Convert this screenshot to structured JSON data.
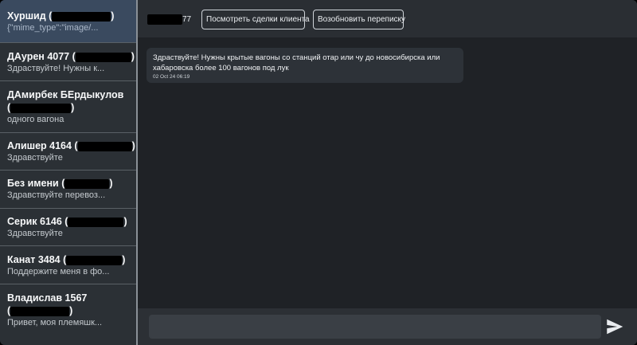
{
  "chats": [
    {
      "name_prefix": "Хуршид (",
      "name_suffix": ")",
      "preview": "{\"mime_type\":\"image/..."
    },
    {
      "name_prefix": "ДАурен 4077 (",
      "name_suffix": ")",
      "preview": "Здраствуйте! Нужны к..."
    },
    {
      "name_line1": "ДАмирбек БЕрдыкулов",
      "name_prefix": "(",
      "name_suffix": ")",
      "preview": "одного вагона"
    },
    {
      "name_prefix": "Алишер 4164 (",
      "name_suffix": ")",
      "preview": "Здравствуйте"
    },
    {
      "name_prefix": "Без имени (",
      "name_suffix": ")",
      "preview": "Здравствуйте перевоз..."
    },
    {
      "name_prefix": "Серик 6146 (",
      "name_suffix": ")",
      "preview": "Здравствуйте"
    },
    {
      "name_prefix": "Канат 3484 (",
      "name_suffix": ")",
      "preview": "Поддержите меня в фо..."
    },
    {
      "name_line1": "Владислав 1567",
      "name_prefix": "(",
      "name_suffix": ")",
      "preview": "Привет, моя племяшк..."
    }
  ],
  "header": {
    "contact_id_suffix": "77",
    "view_deals_label": "Посмотреть сделки клиента",
    "resume_label": "Возобновить переписку"
  },
  "message": {
    "text": "Здраствуйте! Нужны крытые вагоны со станций отар или чу до новосибирска или хабаровска более 100 вагонов под лук",
    "timestamp": "02 Oct 24 06:19"
  },
  "composer": {
    "input_value": "",
    "send_icon": "send-icon"
  },
  "colors": {
    "background": "#1f2226",
    "sidebar": "#2b3035",
    "active_chat": "#3a4a5f",
    "bubble": "#2d3238"
  }
}
